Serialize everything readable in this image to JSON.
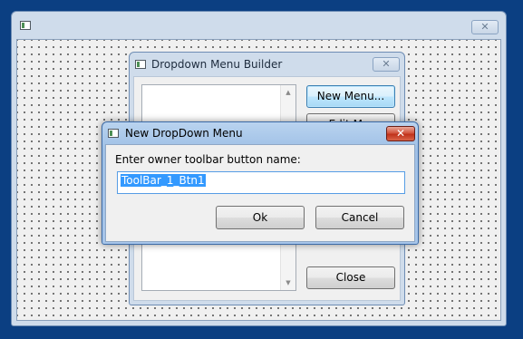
{
  "main_window": {
    "title": "",
    "close_glyph": "✕"
  },
  "builder_dialog": {
    "title": "Dropdown Menu Builder",
    "close_glyph": "✕",
    "buttons": {
      "new_menu": "New Menu...",
      "edit_menu_partial": "Edit M...",
      "close": "Close"
    }
  },
  "new_menu_dialog": {
    "title": "New DropDown Menu",
    "close_glyph": "✕",
    "prompt": "Enter owner toolbar button name:",
    "input_value": "ToolBar_1_Btn1",
    "ok_label": "Ok",
    "cancel_label": "Cancel"
  },
  "icons": {
    "scroll_up": "▲",
    "scroll_down": "▼"
  },
  "colors": {
    "desktop": "#0b3f82",
    "selection": "#3399ff",
    "close_active": "#c0321b"
  }
}
